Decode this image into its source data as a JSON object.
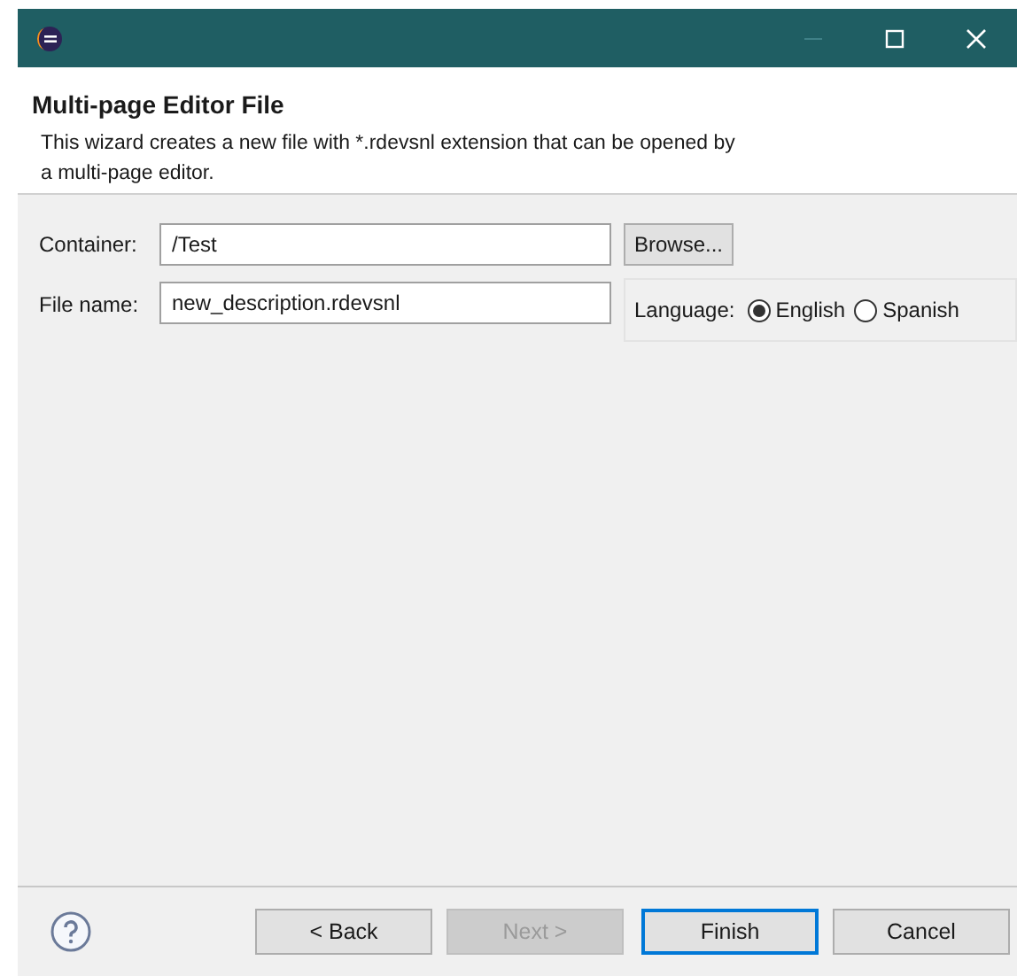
{
  "header": {
    "title": "Multi-page Editor File",
    "description": "This wizard creates a new file with *.rdevsnl extension that can be opened by a multi-page editor."
  },
  "container": {
    "label": "Container:",
    "value": "/Test",
    "button": "Browse..."
  },
  "file_name": {
    "label": "File name:",
    "value": "new_description.rdevsnl"
  },
  "language": {
    "label": "Language:",
    "options": [
      {
        "label": "English",
        "selected": true
      },
      {
        "label": "Spanish",
        "selected": false
      }
    ]
  },
  "buttons": [
    {
      "label": "< Back",
      "disabled": false,
      "default": false
    },
    {
      "label": "Next >",
      "disabled": true,
      "default": false
    },
    {
      "label": "Finish",
      "disabled": false,
      "default": true
    },
    {
      "label": "Cancel",
      "disabled": false,
      "default": false
    }
  ]
}
